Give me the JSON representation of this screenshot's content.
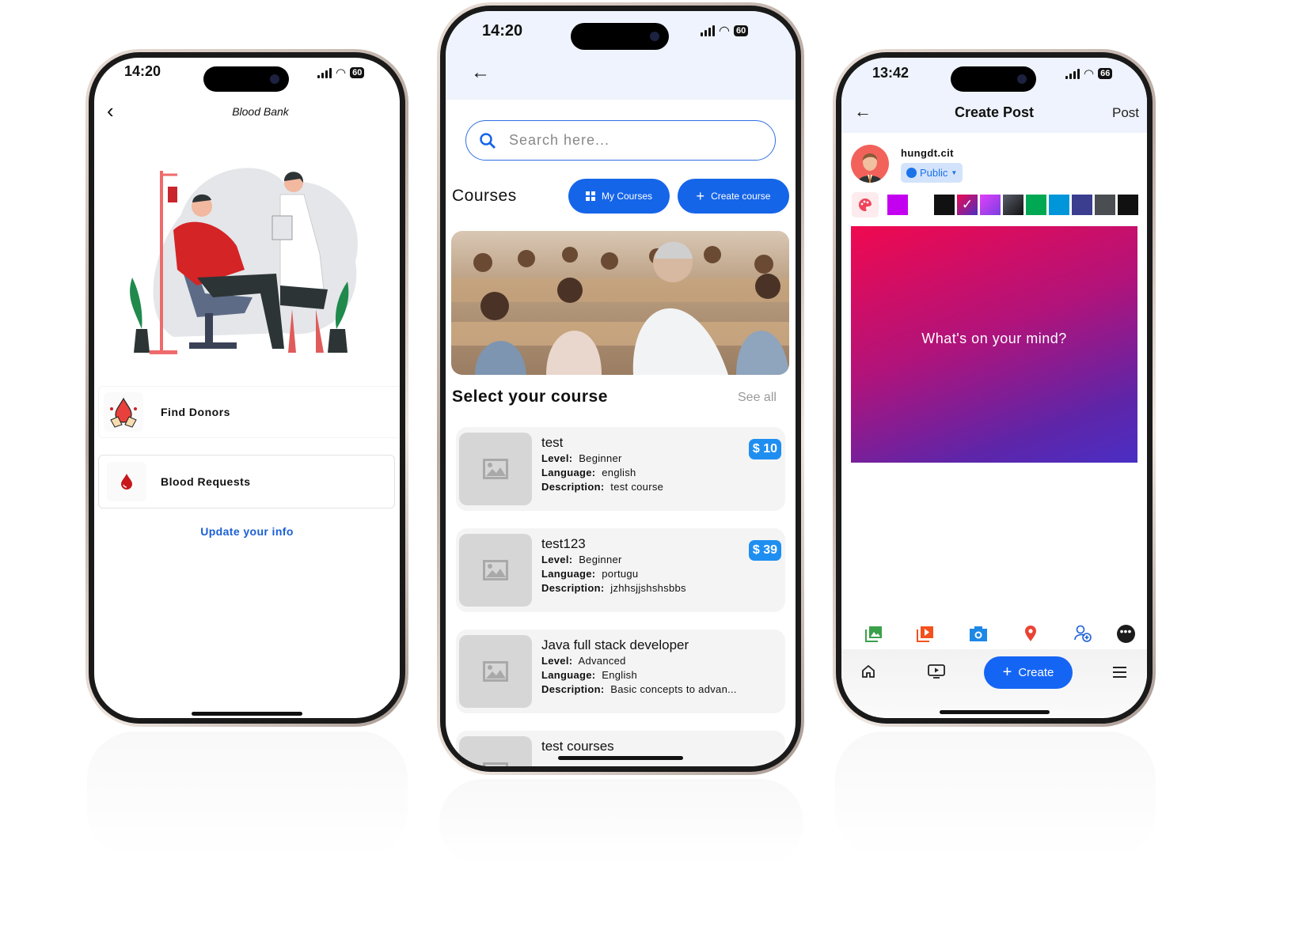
{
  "blood_bank": {
    "status": {
      "time": "14:20",
      "battery": "60"
    },
    "title": "Blood Bank",
    "menu": [
      {
        "label": "Find Donors",
        "icon": "blood-donation-hands-icon"
      },
      {
        "label": "Blood Requests",
        "icon": "blood-drop-icon"
      }
    ],
    "update_link": "Update your info"
  },
  "courses": {
    "status": {
      "time": "14:20",
      "battery": "60"
    },
    "search_placeholder": "Search here...",
    "heading": "Courses",
    "my_courses_label": "My Courses",
    "create_course_label": "Create course",
    "section_title": "Select your course",
    "see_all": "See all",
    "labels": {
      "level": "Level:",
      "language": "Language:",
      "description": "Description:"
    },
    "items": [
      {
        "title": "test",
        "level": "Beginner",
        "language": "english",
        "description": "test course",
        "price": "$ 10"
      },
      {
        "title": "test123",
        "level": "Beginner",
        "language": "portugu",
        "description": "jzhhsjjshshsbbs",
        "price": "$ 39"
      },
      {
        "title": "Java full stack developer",
        "level": "Advanced",
        "language": "English",
        "description": "Basic concepts to advan...",
        "price": ""
      },
      {
        "title": "test courses",
        "level": "",
        "language": "",
        "description": "",
        "price": ""
      }
    ],
    "accent": "#1565e9"
  },
  "create_post": {
    "status": {
      "time": "13:42",
      "battery": "66"
    },
    "title": "Create Post",
    "post_label": "Post",
    "username": "hungdt.cit",
    "privacy": "Public",
    "placeholder": "What's on your mind?",
    "swatches": [
      "#c400f0",
      "#111111",
      "gradient-red-purple",
      "gradient-pink-purple",
      "gradient-dark",
      "#00a854",
      "#0096d9",
      "#3b3d8f",
      "#4a4d52",
      "#111111"
    ],
    "selected_swatch": "gradient-red-purple",
    "toolbar_icons": [
      "photo-icon",
      "video-icon",
      "camera-icon",
      "location-icon",
      "tag-people-icon",
      "more-icon"
    ],
    "create_label": "Create",
    "nav_icons": [
      "home-icon",
      "tv-icon",
      "menu-icon"
    ]
  }
}
